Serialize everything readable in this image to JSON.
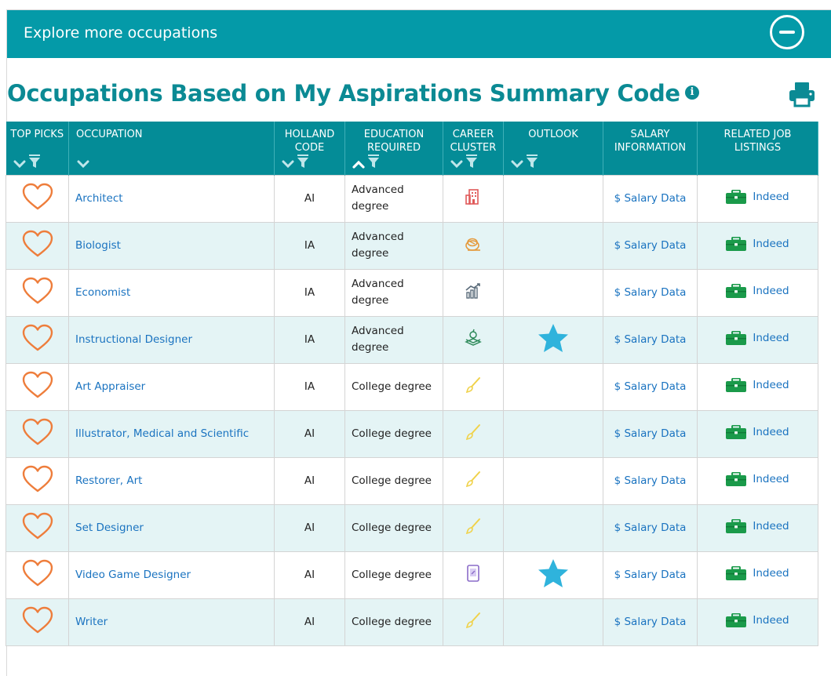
{
  "banner": {
    "title": "Explore more occupations"
  },
  "heading": {
    "title": "Occupations Based on My Aspirations Summary Code"
  },
  "colors": {
    "accent": "#049aa8",
    "header_bg": "#048c97",
    "heart": "#ee7d3b",
    "link": "#1a73c0",
    "star": "#2fb3dc",
    "briefcase": "#1a9a4a",
    "row_alt": "#e4f4f5"
  },
  "table": {
    "columns": [
      {
        "key": "top_picks",
        "label": "TOP PICKS"
      },
      {
        "key": "occupation",
        "label": "OCCUPATION"
      },
      {
        "key": "holland_code",
        "label": "HOLLAND CODE"
      },
      {
        "key": "education",
        "label": "EDUCATION REQUIRED"
      },
      {
        "key": "career_cluster",
        "label": "CAREER CLUSTER"
      },
      {
        "key": "outlook",
        "label": "OUTLOOK"
      },
      {
        "key": "salary",
        "label": "SALARY INFORMATION"
      },
      {
        "key": "jobs",
        "label": "RELATED JOB LISTINGS"
      }
    ],
    "rows": [
      {
        "occupation": "Architect",
        "code": "AI",
        "education": "Advanced degree",
        "cluster_icon": "architecture-icon",
        "bright_outlook": false,
        "salary": "$ Salary Data",
        "jobs": "Indeed"
      },
      {
        "occupation": "Biologist",
        "code": "IA",
        "education": "Advanced degree",
        "cluster_icon": "agriculture-icon",
        "bright_outlook": false,
        "salary": "$ Salary Data",
        "jobs": "Indeed"
      },
      {
        "occupation": "Economist",
        "code": "IA",
        "education": "Advanced degree",
        "cluster_icon": "finance-icon",
        "bright_outlook": false,
        "salary": "$ Salary Data",
        "jobs": "Indeed"
      },
      {
        "occupation": "Instructional Designer",
        "code": "IA",
        "education": "Advanced degree",
        "cluster_icon": "education-icon",
        "bright_outlook": true,
        "salary": "$ Salary Data",
        "jobs": "Indeed"
      },
      {
        "occupation": "Art Appraiser",
        "code": "IA",
        "education": "College degree",
        "cluster_icon": "arts-icon",
        "bright_outlook": false,
        "salary": "$ Salary Data",
        "jobs": "Indeed"
      },
      {
        "occupation": "Illustrator, Medical and Scientific",
        "code": "AI",
        "education": "College degree",
        "cluster_icon": "arts-icon",
        "bright_outlook": false,
        "salary": "$ Salary Data",
        "jobs": "Indeed"
      },
      {
        "occupation": "Restorer, Art",
        "code": "AI",
        "education": "College degree",
        "cluster_icon": "arts-icon",
        "bright_outlook": false,
        "salary": "$ Salary Data",
        "jobs": "Indeed"
      },
      {
        "occupation": "Set Designer",
        "code": "AI",
        "education": "College degree",
        "cluster_icon": "arts-icon",
        "bright_outlook": false,
        "salary": "$ Salary Data",
        "jobs": "Indeed"
      },
      {
        "occupation": "Video Game Designer",
        "code": "AI",
        "education": "College degree",
        "cluster_icon": "information-technology-icon",
        "bright_outlook": true,
        "salary": "$ Salary Data",
        "jobs": "Indeed"
      },
      {
        "occupation": "Writer",
        "code": "AI",
        "education": "College degree",
        "cluster_icon": "arts-icon",
        "bright_outlook": false,
        "salary": "$ Salary Data",
        "jobs": "Indeed"
      }
    ]
  }
}
